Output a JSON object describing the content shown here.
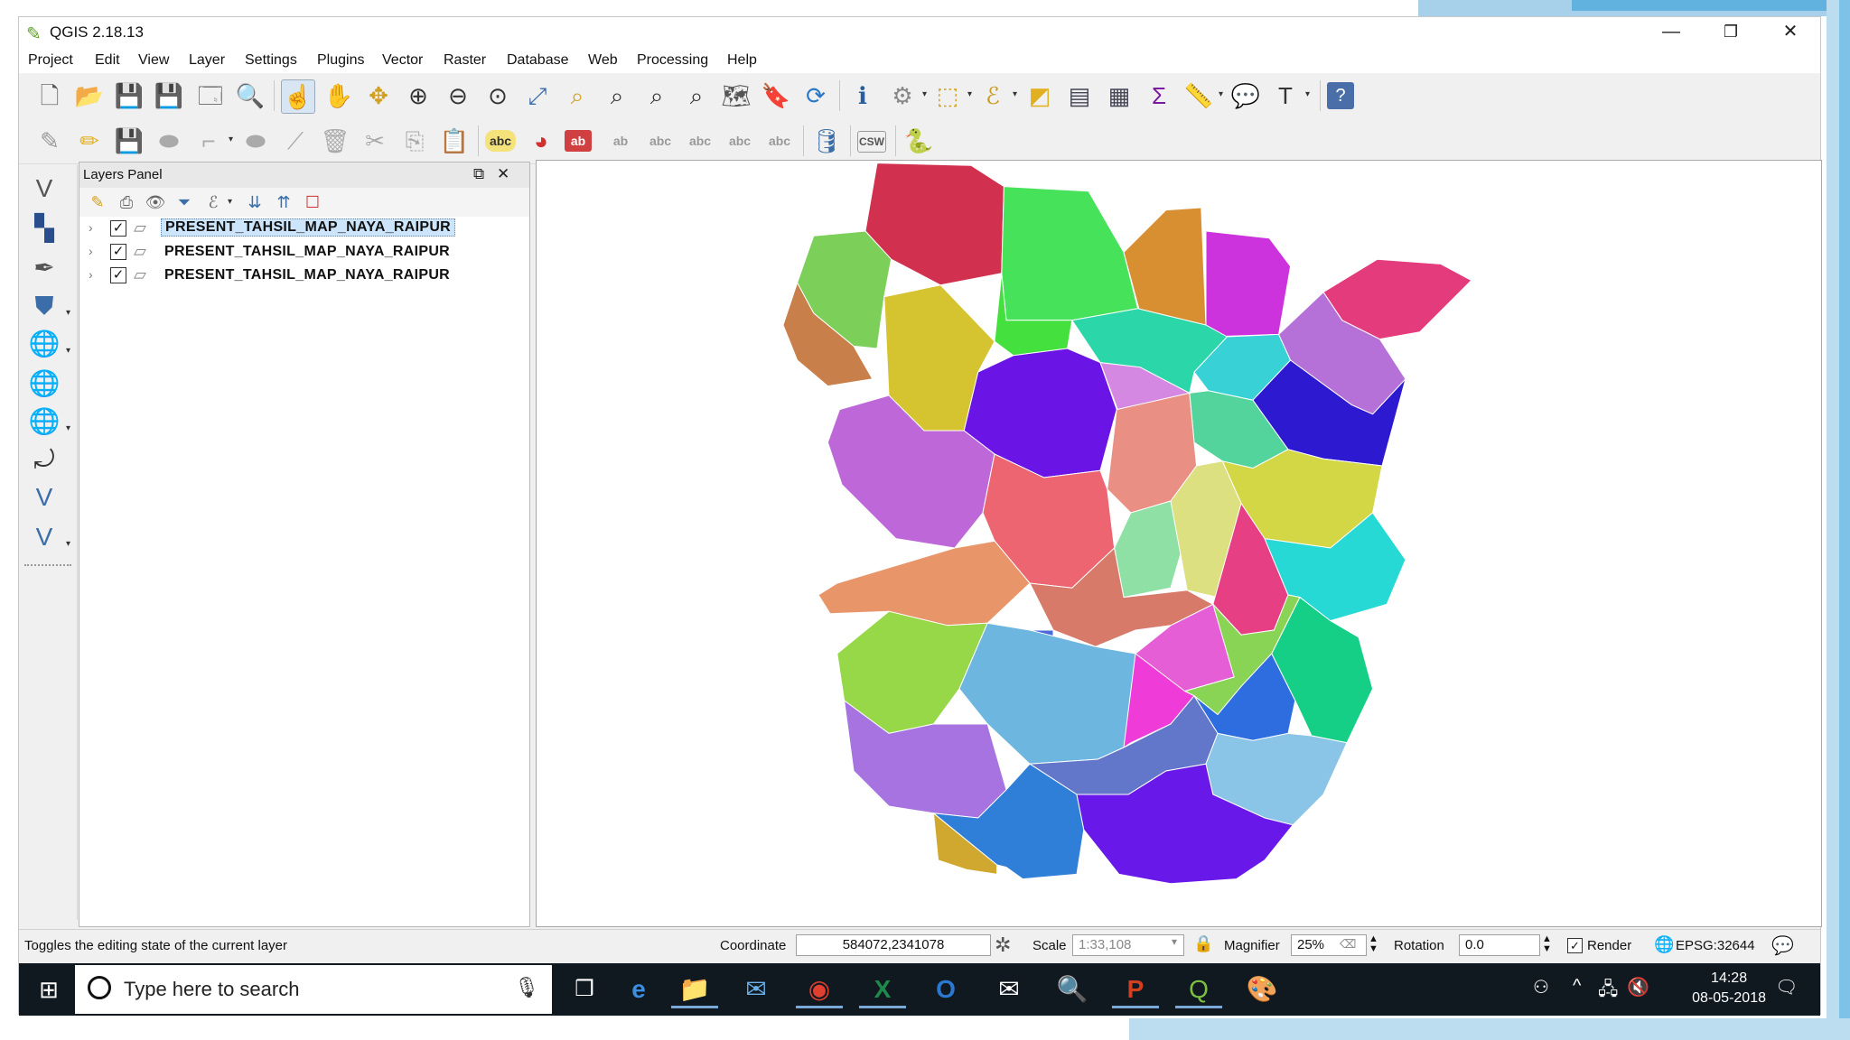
{
  "window": {
    "title": "QGIS 2.18.13",
    "controls": {
      "minimize": "—",
      "restore": "❐",
      "close": "✕"
    }
  },
  "menu": [
    "Project",
    "Edit",
    "View",
    "Layer",
    "Settings",
    "Plugins",
    "Vector",
    "Raster",
    "Database",
    "Web",
    "Processing",
    "Help"
  ],
  "toolbar_labels": {
    "csw": "CSW",
    "abc": "abc",
    "ab": "ab"
  },
  "layers_panel": {
    "title": "Layers Panel",
    "layers": [
      {
        "name": "PRESENT_TAHSIL_MAP_NAYA_RAIPUR",
        "checked": true,
        "selected": true
      },
      {
        "name": "PRESENT_TAHSIL_MAP_NAYA_RAIPUR",
        "checked": true,
        "selected": false
      },
      {
        "name": "PRESENT_TAHSIL_MAP_NAYA_RAIPUR",
        "checked": true,
        "selected": false
      }
    ]
  },
  "map": {
    "regions": [
      {
        "color": "#d1314e",
        "label": ""
      },
      {
        "color": "#46e25a",
        "label": ""
      },
      {
        "color": "#d88f32",
        "label": ""
      },
      {
        "color": "#cd33dd",
        "label": ""
      },
      {
        "color": "#e43b7c",
        "label": ""
      },
      {
        "color": "#7cd05a",
        "label": ""
      },
      {
        "color": "#c97f4a",
        "label": ""
      },
      {
        "color": "#44e03e",
        "label": ""
      },
      {
        "color": "#37d1d6",
        "label": ""
      },
      {
        "color": "#b571d8",
        "label": ""
      },
      {
        "color": "#2bd6a8",
        "label": ""
      },
      {
        "color": "#d6c330",
        "label": ""
      },
      {
        "color": "#6a14e6",
        "label": ""
      },
      {
        "color": "#d588e2",
        "label": ""
      },
      {
        "color": "#53d49c",
        "label": ""
      },
      {
        "color": "#2d1ad0",
        "label": ""
      },
      {
        "color": "#bd67d8",
        "label": ""
      },
      {
        "color": "#e98f84",
        "label": ""
      },
      {
        "color": "#d3d645",
        "label": ""
      },
      {
        "color": "#ec6571",
        "label": ""
      },
      {
        "color": "#8ee0a5",
        "label": ""
      },
      {
        "color": "#dce081",
        "label": ""
      },
      {
        "color": "#e63f83",
        "label": ""
      },
      {
        "color": "#27d9d4",
        "label": ""
      },
      {
        "color": "#e9956a",
        "label": ""
      },
      {
        "color": "#d77a6a",
        "label": ""
      },
      {
        "color": "#97d848",
        "label": ""
      },
      {
        "color": "#e65ed5",
        "label": ""
      },
      {
        "color": "#4b68db",
        "label": ""
      },
      {
        "color": "#6cb6e0",
        "label": ""
      },
      {
        "color": "#8ad455",
        "label": ""
      },
      {
        "color": "#ef3bd8",
        "label": ""
      },
      {
        "color": "#2e6ddf",
        "label": ""
      },
      {
        "color": "#16cf86",
        "label": ""
      },
      {
        "color": "#a673e0",
        "label": ""
      },
      {
        "color": "#6277c9",
        "label": ""
      },
      {
        "color": "#8ac4e6",
        "label": ""
      },
      {
        "color": "#2f7ed8",
        "label": ""
      },
      {
        "color": "#d0a830",
        "label": ""
      },
      {
        "color": "#6818e8",
        "label": ""
      }
    ]
  },
  "status": {
    "message": "Toggles the editing state of the current layer",
    "coordinate_label": "Coordinate",
    "coordinate_value": "584072,2341078",
    "scale_label": "Scale",
    "scale_value": "1:33,108",
    "magnifier_label": "Magnifier",
    "magnifier_value": "25%",
    "rotation_label": "Rotation",
    "rotation_value": "0.0",
    "render_label": "Render",
    "crs": "EPSG:32644"
  },
  "taskbar": {
    "search_placeholder": "Type here to search",
    "time": "14:28",
    "date": "08-05-2018"
  },
  "colors": {
    "accent_blue": "#62b2e0",
    "taskbar": "#101820",
    "selection": "#cde5fb"
  }
}
